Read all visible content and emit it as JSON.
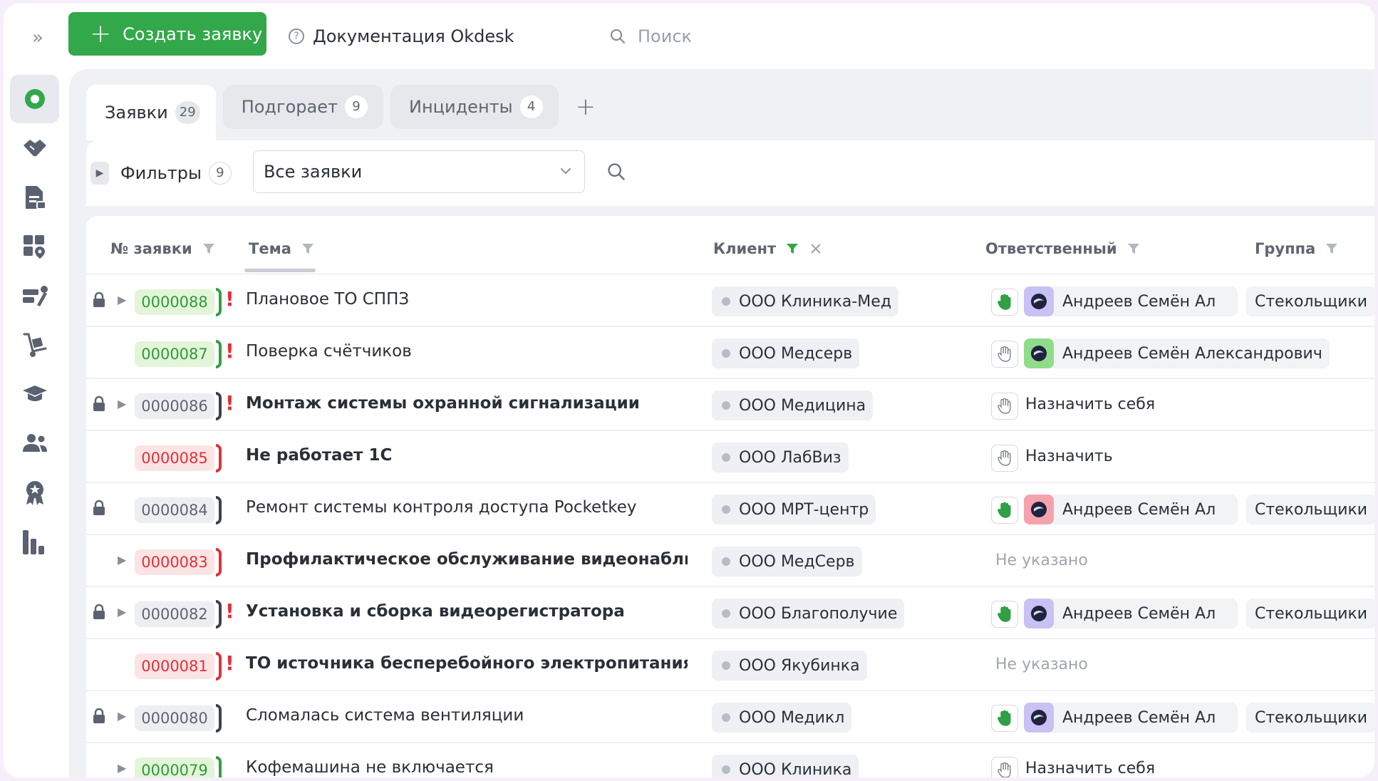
{
  "topbar": {
    "create_label": "Создать заявку",
    "docs_label": "Документация Okdesk",
    "search_placeholder": "Поиск"
  },
  "sidebar": {
    "items": [
      {
        "icon": "status-circle-icon",
        "active": true
      },
      {
        "icon": "handshake-icon"
      },
      {
        "icon": "document-icon"
      },
      {
        "icon": "objects-location-icon"
      },
      {
        "icon": "tools-icon"
      },
      {
        "icon": "hand-truck-icon"
      },
      {
        "icon": "graduation-cap-icon"
      },
      {
        "icon": "users-icon"
      },
      {
        "icon": "badge-icon"
      },
      {
        "icon": "bar-chart-icon"
      }
    ]
  },
  "tabs": [
    {
      "label": "Заявки",
      "count": "29",
      "active": true
    },
    {
      "label": "Подгорает",
      "count": "9"
    },
    {
      "label": "Инциденты",
      "count": "4"
    }
  ],
  "filters": {
    "label": "Фильтры",
    "count": "9",
    "selected": "Все заявки"
  },
  "columns": {
    "number": "№ заявки",
    "subject": "Тема",
    "client": "Клиент",
    "assignee": "Ответственный",
    "group": "Группа"
  },
  "rows": [
    {
      "number": "0000088",
      "num_style": "green",
      "bracket": "green",
      "urgent": true,
      "locked": true,
      "expandable": true,
      "subject": "Плановое ТО СППЗ",
      "bold": false,
      "client": "ООО Клиника-Мед",
      "hand_active": true,
      "assignee": "Андреев Семён Ал",
      "avatar_color": "#c9c1f3",
      "group": "Стекольщики"
    },
    {
      "number": "0000087",
      "num_style": "green",
      "bracket": "green",
      "urgent": true,
      "locked": false,
      "expandable": false,
      "subject": "Поверка счётчиков",
      "bold": false,
      "client": "ООО Медсерв",
      "hand_active": false,
      "assignee": "Андреев Семён Александрович",
      "avatar_color": "#8fdc8a"
    },
    {
      "number": "0000086",
      "num_style": "gray",
      "bracket": "gray",
      "urgent": true,
      "locked": true,
      "expandable": true,
      "subject": "Монтаж системы охранной сигнализации",
      "bold": true,
      "client": "ООО Медицина",
      "hand_active": false,
      "assign_text": "Назначить себя"
    },
    {
      "number": "0000085",
      "num_style": "red",
      "bracket": "red",
      "urgent": false,
      "locked": false,
      "expandable": false,
      "subject": "Не работает 1С",
      "bold": true,
      "client": "ООО ЛабВиз",
      "hand_active": false,
      "assign_text": "Назначить"
    },
    {
      "number": "0000084",
      "num_style": "gray",
      "bracket": "gray",
      "urgent": false,
      "locked": true,
      "expandable": false,
      "subject": "Ремонт системы контроля доступа Pocketkey",
      "bold": false,
      "client": "ООО МРТ-центр",
      "hand_active": true,
      "assignee": "Андреев Семён Ал",
      "avatar_color": "#f4a3ad",
      "group": "Стекольщики"
    },
    {
      "number": "0000083",
      "num_style": "red",
      "bracket": "red",
      "urgent": false,
      "locked": false,
      "expandable": true,
      "subject": "Профилактическое обслуживание видеонаблюден",
      "bold": true,
      "client": "ООО МедСерв",
      "not_set": "Не указано"
    },
    {
      "number": "0000082",
      "num_style": "gray",
      "bracket": "gray",
      "urgent": true,
      "locked": true,
      "expandable": true,
      "subject": "Установка и сборка видеорегистратора",
      "bold": true,
      "client": "ООО Благополучие",
      "hand_active": true,
      "assignee": "Андреев Семён Ал",
      "avatar_color": "#c9c1f3",
      "group": "Стекольщики"
    },
    {
      "number": "0000081",
      "num_style": "red",
      "bracket": "red",
      "urgent": true,
      "locked": false,
      "expandable": false,
      "subject": "ТО источника бесперебойного электропитания",
      "bold": true,
      "client": "ООО Якубинка",
      "not_set": "Не указано"
    },
    {
      "number": "0000080",
      "num_style": "gray",
      "bracket": "gray",
      "urgent": false,
      "locked": true,
      "expandable": true,
      "subject": "Сломалась система вентиляции",
      "bold": false,
      "client": "ООО Медикл",
      "hand_active": true,
      "assignee": "Андреев Семён Ал",
      "avatar_color": "#c9c1f3",
      "group": "Стекольщики"
    },
    {
      "number": "0000079",
      "num_style": "green",
      "bracket": "green",
      "urgent": false,
      "locked": false,
      "expandable": true,
      "subject": "Кофемашина не включается",
      "bold": false,
      "client": "ООО Клиника",
      "hand_active": false,
      "assign_text": "Назначить себя"
    }
  ],
  "colors": {
    "accent": "#33a84a",
    "danger": "#e0303b"
  }
}
